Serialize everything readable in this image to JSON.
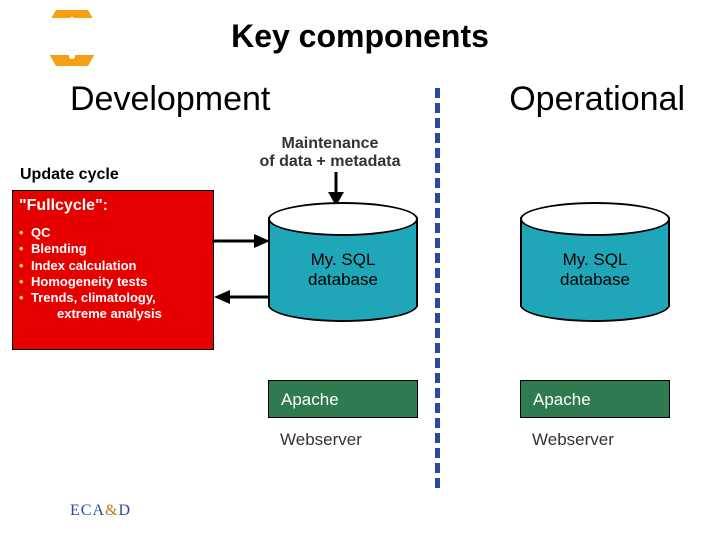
{
  "title": "Key components",
  "sections": {
    "left": "Development",
    "right": "Operational"
  },
  "maintenance": {
    "line1": "Maintenance",
    "line2": "of data + metadata"
  },
  "update_cycle": "Update cycle",
  "fullcycle": {
    "heading": "\"Fullcycle\":",
    "items": [
      "QC",
      "Blending",
      "Index calculation",
      "Homogeneity tests",
      "Trends, climatology,",
      "extreme analysis"
    ]
  },
  "db": {
    "dev_line1": "My. SQL",
    "dev_line2": "database",
    "op_line1": "My. SQL",
    "op_line2": "database"
  },
  "apache": {
    "dev": "Apache",
    "op": "Apache"
  },
  "webserver": {
    "dev": "Webserver",
    "op": "Webserver"
  },
  "logo": {
    "a": "ECA",
    "amp": "&",
    "d": "D"
  }
}
